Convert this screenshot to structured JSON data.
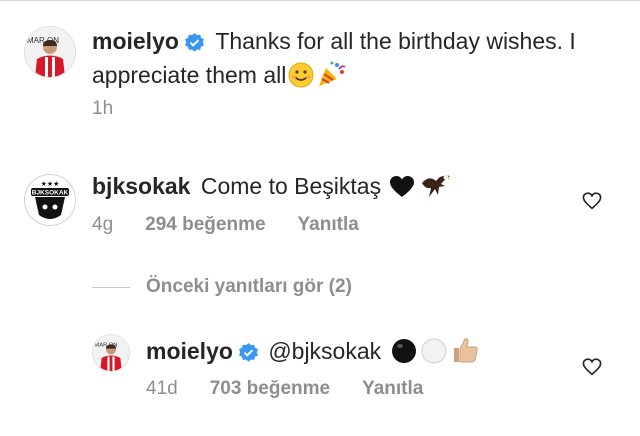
{
  "caption": {
    "username": "moielyo",
    "text": "Thanks for all the birthday wishes. I appreciate them all",
    "time": "1h"
  },
  "comments": [
    {
      "username": "bjksokak",
      "text": "Come to Beşiktaş",
      "time": "4g",
      "likes": "294 beğenme",
      "reply_label": "Yanıtla"
    }
  ],
  "view_replies_label": "Önceki yanıtları gör (2)",
  "reply": {
    "username": "moielyo",
    "mention": "@bjksokak",
    "time": "41d",
    "likes": "703 beğenme",
    "reply_label": "Yanıtla"
  },
  "avatar_texts": {
    "moielyo_banner": "MAR   ON",
    "bjk_badge": "BJKSOKAK"
  },
  "icons": [
    "verified-badge-icon",
    "smile-emoji-icon",
    "party-popper-emoji-icon",
    "black-heart-emoji-icon",
    "eagle-emoji-icon",
    "black-circle-emoji-icon",
    "white-circle-emoji-icon",
    "thumbs-up-emoji-icon",
    "heart-outline-icon"
  ],
  "colors": {
    "verified": "#3897f0",
    "meta_gray": "#8e8e8e",
    "text": "#262626"
  }
}
